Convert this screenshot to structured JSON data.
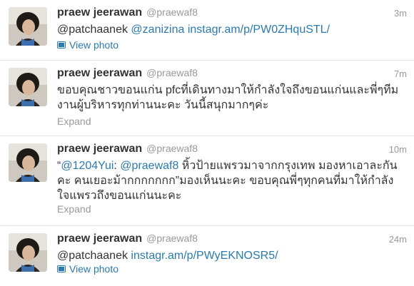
{
  "tweets": [
    {
      "name": "praew jeerawan",
      "handle": "@praewaf8",
      "time": "3m",
      "parts": [
        {
          "text": "@patchaanek ",
          "link": false
        },
        {
          "text": "@zanizina",
          "link": true
        },
        {
          "text": " ",
          "link": false
        },
        {
          "text": "instagr.am/p/PW0ZHquSTL/",
          "link": true
        }
      ],
      "action": "View photo",
      "action_type": "photo"
    },
    {
      "name": "praew jeerawan",
      "handle": "@praewaf8",
      "time": "7m",
      "parts": [
        {
          "text": "ขอบคุณชาวขอนแก่น pfcที่เดินทางมาให้กำลังใจถึงขอนแก่นและพี่ๆทีมงานผู้บริหารทุกท่านนะคะ วันนี้สนุกมากๆค่ะ",
          "link": false
        }
      ],
      "action": "Expand",
      "action_type": "expand"
    },
    {
      "name": "praew jeerawan",
      "handle": "@praewaf8",
      "time": "10m",
      "parts": [
        {
          "text": "“",
          "link": false
        },
        {
          "text": "@1204Yui",
          "link": true
        },
        {
          "text": ": ",
          "link": false
        },
        {
          "text": "@praewaf8",
          "link": true
        },
        {
          "text": " หิ้วป้ายแพรวมาจากกรุงเทพ มองหาเอาละกันคะ คนเยอะม้ากกกกกกก”มองเห็นนะคะ ขอบคุณพี่ๆทุกคนที่มาให้กำลังใจแพรวถึงขอนแก่นนะคะ",
          "link": false
        }
      ],
      "action": "Expand",
      "action_type": "expand"
    },
    {
      "name": "praew jeerawan",
      "handle": "@praewaf8",
      "time": "24m",
      "parts": [
        {
          "text": "@patchaanek ",
          "link": false
        },
        {
          "text": "instagr.am/p/PWyEKNOSR5/",
          "link": true
        }
      ],
      "action": "View photo",
      "action_type": "photo"
    }
  ],
  "colors": {
    "link": "#2a7ab0",
    "meta": "#999999",
    "text": "#333333",
    "divider": "#e8e8e8"
  },
  "icons": {
    "photo": "photo-icon",
    "avatar": "avatar"
  }
}
